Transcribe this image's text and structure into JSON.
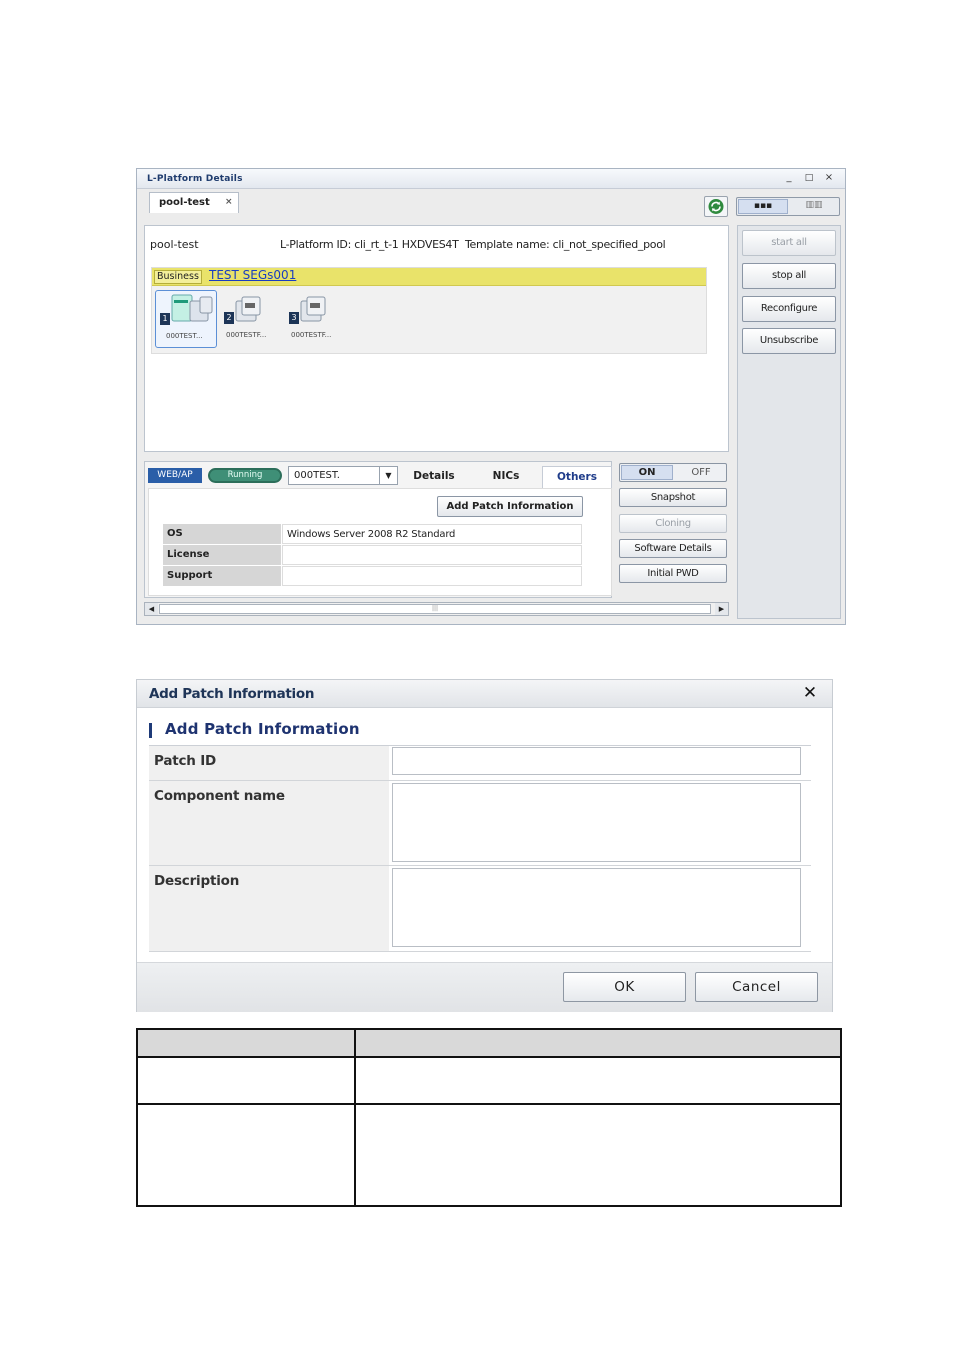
{
  "lplatform_window": {
    "title": "L-Platform Details",
    "controls": {
      "minimize": "_",
      "maximize": "□",
      "close": "×"
    },
    "tab": {
      "label": "pool-test",
      "close": "×"
    },
    "view_toggle": {
      "a": "▪▪▪",
      "b": "▥▥"
    },
    "pool_name": "pool-test",
    "lplatform_id_label": "L-Platform ID:",
    "lplatform_id": "cli_rt_t-1 HXDVES4T",
    "template_label": "Template name:",
    "template_name": "cli_not_specified_pool",
    "business_label": "Business",
    "segment_link": "TEST SEGs001",
    "servers": [
      {
        "num": "1",
        "name": "000TEST..."
      },
      {
        "num": "2",
        "name": "000TESTF..."
      },
      {
        "num": "3",
        "name": "000TESTF..."
      }
    ],
    "server_type": "WEB/AP",
    "status": "Running",
    "server_select": "000TEST.",
    "subtabs": [
      "Details",
      "NICs",
      "Others"
    ],
    "add_patch_button": "Add Patch Information",
    "info_rows": [
      {
        "label": "OS",
        "value": "Windows Server 2008 R2 Standard"
      },
      {
        "label": "License",
        "value": ""
      },
      {
        "label": "Support",
        "value": ""
      }
    ],
    "power": {
      "on": "ON",
      "off": "OFF"
    },
    "side_buttons": [
      {
        "label": "Snapshot",
        "enabled": true
      },
      {
        "label": "Cloning",
        "enabled": false
      },
      {
        "label": "Software Details",
        "enabled": true
      },
      {
        "label": "Initial PWD",
        "enabled": true
      }
    ],
    "right_buttons": [
      {
        "label": "start all",
        "enabled": false
      },
      {
        "label": "stop all",
        "enabled": true
      },
      {
        "label": "Reconfigure",
        "enabled": true
      },
      {
        "label": "Unsubscribe",
        "enabled": true
      }
    ]
  },
  "dialog": {
    "title": "Add Patch Information",
    "close": "✕",
    "section_title": "Add Patch Information",
    "fields": {
      "patch_id": {
        "label": "Patch ID",
        "value": ""
      },
      "component_name": {
        "label": "Component name",
        "value": ""
      },
      "description": {
        "label": "Description",
        "value": ""
      }
    },
    "ok": "OK",
    "cancel": "Cancel"
  },
  "colors": {
    "business_bar": "#e9e36a",
    "running": "#3f8f77",
    "web_ap": "#2a5ea8",
    "dialog_title": "#1e3457"
  }
}
